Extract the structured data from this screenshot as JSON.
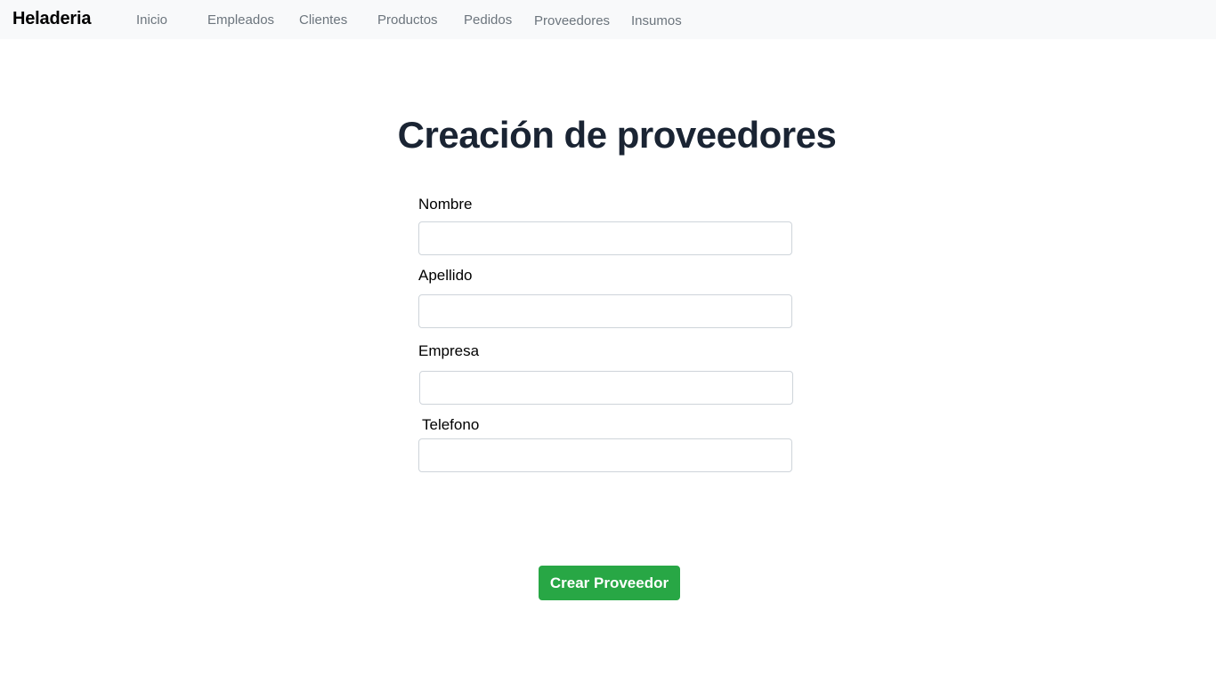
{
  "navbar": {
    "brand": "Heladeria",
    "links": [
      "Inicio",
      "Empleados",
      "Clientes",
      "Productos",
      "Pedidos",
      "Proveedores",
      "Insumos"
    ]
  },
  "page": {
    "title": "Creación de proveedores"
  },
  "form": {
    "fields": [
      {
        "label": "Nombre",
        "value": "",
        "placeholder": ""
      },
      {
        "label": "Apellido",
        "value": "",
        "placeholder": ""
      },
      {
        "label": "Empresa",
        "value": "",
        "placeholder": ""
      },
      {
        "label": "Telefono",
        "value": "",
        "placeholder": ""
      }
    ],
    "submit_label": "Crear Proveedor"
  },
  "colors": {
    "navbar_bg": "#f8f9fa",
    "submit_bg": "#28a745",
    "nav_link": "#6c757d"
  }
}
